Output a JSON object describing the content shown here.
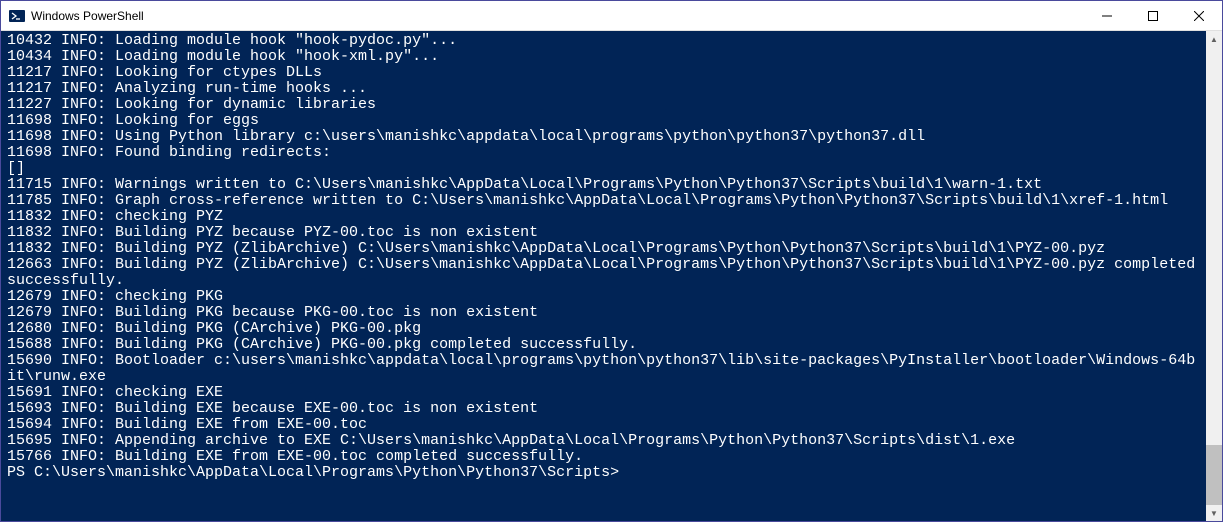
{
  "window": {
    "title": "Windows PowerShell"
  },
  "terminal": {
    "lines": [
      "10432 INFO: Loading module hook \"hook-pydoc.py\"...",
      "10434 INFO: Loading module hook \"hook-xml.py\"...",
      "11217 INFO: Looking for ctypes DLLs",
      "11217 INFO: Analyzing run-time hooks ...",
      "11227 INFO: Looking for dynamic libraries",
      "11698 INFO: Looking for eggs",
      "11698 INFO: Using Python library c:\\users\\manishkc\\appdata\\local\\programs\\python\\python37\\python37.dll",
      "11698 INFO: Found binding redirects:",
      "[]",
      "11715 INFO: Warnings written to C:\\Users\\manishkc\\AppData\\Local\\Programs\\Python\\Python37\\Scripts\\build\\1\\warn-1.txt",
      "11785 INFO: Graph cross-reference written to C:\\Users\\manishkc\\AppData\\Local\\Programs\\Python\\Python37\\Scripts\\build\\1\\xref-1.html",
      "11832 INFO: checking PYZ",
      "11832 INFO: Building PYZ because PYZ-00.toc is non existent",
      "11832 INFO: Building PYZ (ZlibArchive) C:\\Users\\manishkc\\AppData\\Local\\Programs\\Python\\Python37\\Scripts\\build\\1\\PYZ-00.pyz",
      "12663 INFO: Building PYZ (ZlibArchive) C:\\Users\\manishkc\\AppData\\Local\\Programs\\Python\\Python37\\Scripts\\build\\1\\PYZ-00.pyz completed successfully.",
      "12679 INFO: checking PKG",
      "12679 INFO: Building PKG because PKG-00.toc is non existent",
      "12680 INFO: Building PKG (CArchive) PKG-00.pkg",
      "15688 INFO: Building PKG (CArchive) PKG-00.pkg completed successfully.",
      "15690 INFO: Bootloader c:\\users\\manishkc\\appdata\\local\\programs\\python\\python37\\lib\\site-packages\\PyInstaller\\bootloader\\Windows-64bit\\runw.exe",
      "15691 INFO: checking EXE",
      "15693 INFO: Building EXE because EXE-00.toc is non existent",
      "15694 INFO: Building EXE from EXE-00.toc",
      "15695 INFO: Appending archive to EXE C:\\Users\\manishkc\\AppData\\Local\\Programs\\Python\\Python37\\Scripts\\dist\\1.exe",
      "15766 INFO: Building EXE from EXE-00.toc completed successfully."
    ],
    "prompt": "PS C:\\Users\\manishkc\\AppData\\Local\\Programs\\Python\\Python37\\Scripts>"
  }
}
